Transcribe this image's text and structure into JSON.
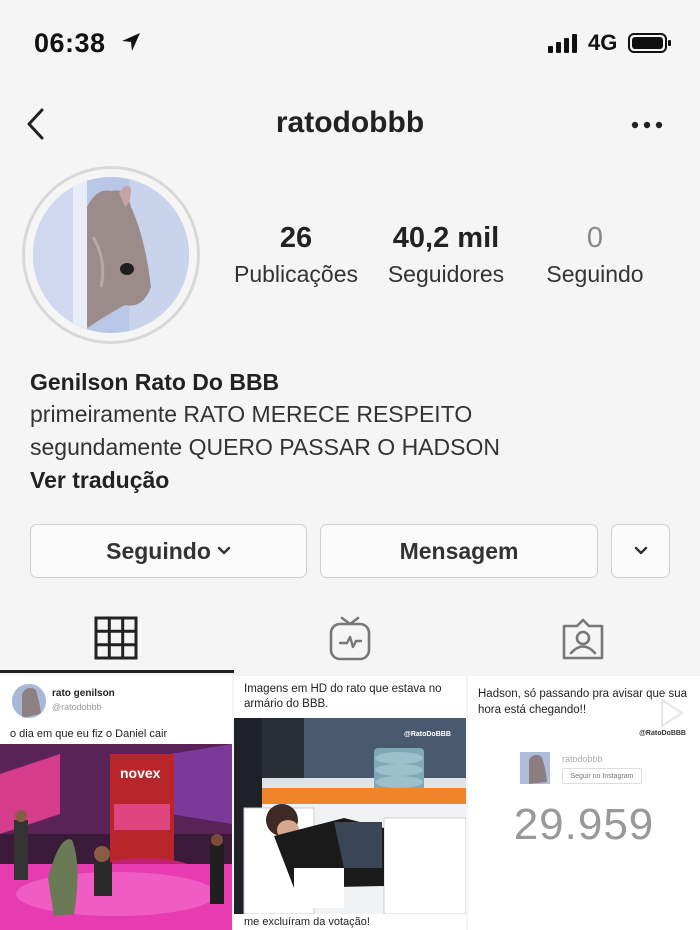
{
  "status_bar": {
    "time": "06:38",
    "network": "4G",
    "icons": [
      "location-arrow-icon",
      "signal-bars-icon",
      "battery-icon"
    ]
  },
  "header": {
    "username": "ratodobbb",
    "icons": [
      "back-chevron-icon",
      "more-dots-icon"
    ]
  },
  "profile": {
    "stats": {
      "posts": {
        "value": "26",
        "label": "Publicações"
      },
      "followers": {
        "value": "40,2 mil",
        "label": "Seguidores"
      },
      "following": {
        "value": "0",
        "label": "Seguindo"
      }
    },
    "name": "Genilson Rato Do BBB",
    "bio": [
      "primeiramente RATO MERECE RESPEITO",
      "segundamente QUERO PASSAR O HADSON"
    ],
    "translate_link": "Ver tradução"
  },
  "actions": {
    "following": "Seguindo",
    "message": "Mensagem"
  },
  "tabs": [
    "grid-icon",
    "igtv-icon",
    "tagged-icon"
  ],
  "posts": [
    {
      "name": "rato genilson",
      "handle": "@ratodobbb",
      "caption": "o dia em que eu fiz o Daniel cair",
      "sign_text": "novex"
    },
    {
      "caption": "Imagens em HD do rato que estava no armário do BBB.",
      "watermark": "@RatoDoBBB",
      "footer": "me excluíram da votação!"
    },
    {
      "caption": "Hadson, só passando pra avisar que sua hora está chegando!!",
      "watermark": "@RatoDoBBB",
      "handle": "ratodobbb",
      "follow_label": "Seguir no Instagram",
      "count": "29.959"
    }
  ],
  "colors": {
    "background": "#f5f5f5",
    "text": "#222222",
    "border": "#cfcfcf",
    "muted": "#888888"
  }
}
